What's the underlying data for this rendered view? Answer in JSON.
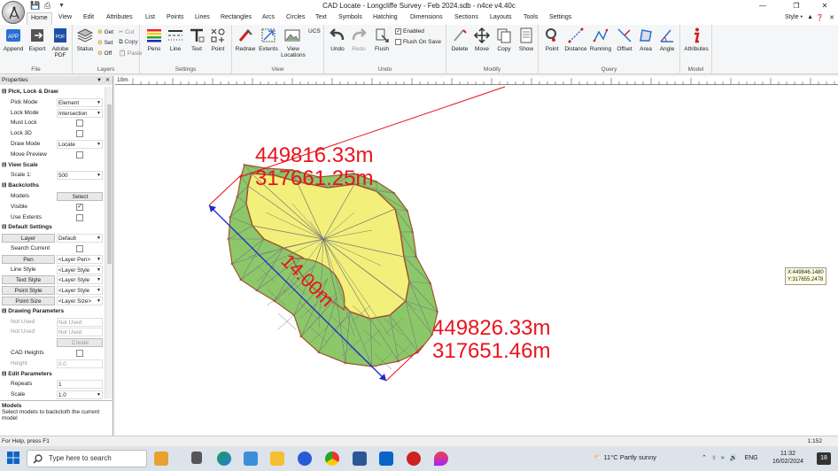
{
  "window": {
    "title": "CAD Locate - Longcliffe Survey - Feb 2024.sdb - n4ce v4.40c",
    "minimize": "—",
    "maximize": "❐",
    "close": "✕",
    "style_label": "Style •"
  },
  "menu_tabs": [
    "Home",
    "View",
    "Edit",
    "Attributes",
    "List",
    "Points",
    "Lines",
    "Rectangles",
    "Arcs",
    "Circles",
    "Text",
    "Symbols",
    "Hatching",
    "Dimensions",
    "Sections",
    "Layouts",
    "Tools",
    "Settings"
  ],
  "ribbon": {
    "file": {
      "label": "File",
      "buttons": [
        "Append",
        "Export",
        "Adobe PDF"
      ]
    },
    "layers": {
      "label": "Layers",
      "status": "Status",
      "get": "Get",
      "cut": "Cut",
      "set": "Set",
      "copy": "Copy",
      "off": "Off",
      "paste": "Paste"
    },
    "settings": {
      "label": "Settings",
      "buttons": [
        "Pens",
        "Line",
        "Text",
        "Point"
      ]
    },
    "view": {
      "label": "View",
      "buttons": [
        "Redraw",
        "Extents",
        "View Locations"
      ],
      "ucs": "UCS"
    },
    "undo": {
      "label": "Undo",
      "buttons": [
        "Undo",
        "Redo",
        "Flush"
      ],
      "enabled": "Enabled",
      "flush_on_save": "Flush On Save"
    },
    "modify": {
      "label": "Modify",
      "buttons": [
        "Delete",
        "Move",
        "Copy",
        "Show"
      ]
    },
    "query": {
      "label": "Query",
      "buttons": [
        "Point",
        "Distance",
        "Running",
        "Offset",
        "Area",
        "Angle"
      ]
    },
    "model": {
      "label": "Model",
      "buttons": [
        "Attributes"
      ]
    }
  },
  "panel": {
    "title": "Properties",
    "sections": [
      {
        "title": "Pick, Lock & Draw",
        "rows": [
          {
            "key": "Pick Mode",
            "value": "Element",
            "type": "dropdown"
          },
          {
            "key": "Lock Mode",
            "value": "Intersection",
            "type": "dropdown"
          },
          {
            "key": "Must Lock",
            "value": "",
            "type": "checkbox",
            "checked": false
          },
          {
            "key": "Lock 3D",
            "value": "",
            "type": "checkbox",
            "checked": false
          },
          {
            "key": "Draw Mode",
            "value": "Locate",
            "type": "dropdown"
          },
          {
            "key": "Move Preview",
            "value": "",
            "type": "checkbox",
            "checked": false
          }
        ]
      },
      {
        "title": "View Scale",
        "rows": [
          {
            "key": "Scale 1:",
            "value": "500",
            "type": "dropdown"
          }
        ]
      },
      {
        "title": "Backcloths",
        "rows": [
          {
            "key": "Models",
            "value": "Select",
            "type": "button"
          },
          {
            "key": "Visible",
            "value": "",
            "type": "checkbox",
            "checked": true
          },
          {
            "key": "Use Extents",
            "value": "",
            "type": "checkbox",
            "checked": false
          }
        ]
      },
      {
        "title": "Default Settings",
        "rows": [
          {
            "key": "Layer",
            "value": "Default",
            "type": "dropdown",
            "keybtn": true
          },
          {
            "key": "Search Current",
            "value": "",
            "type": "checkbox",
            "checked": false
          },
          {
            "key": "Pen",
            "value": "<Layer Pen>",
            "type": "dropdown",
            "keybtn": true
          },
          {
            "key": "Line Style",
            "value": "<Layer Style",
            "type": "dropdown"
          },
          {
            "key": "Text Style",
            "value": "<Layer Style",
            "type": "dropdown",
            "keybtn": true
          },
          {
            "key": "Point Style",
            "value": "<Layer Style",
            "type": "dropdown",
            "keybtn": true
          },
          {
            "key": "Point Size",
            "value": "<Layer Size>",
            "type": "dropdown",
            "keybtn": true
          }
        ]
      },
      {
        "title": "Drawing Parameters",
        "rows": [
          {
            "key": "Not Used",
            "value": "Not Used",
            "type": "disabled"
          },
          {
            "key": "Not Used",
            "value": "Not Used",
            "type": "disabled"
          },
          {
            "key": "",
            "value": "Create",
            "type": "button-disabled"
          },
          {
            "key": "CAD Heights",
            "value": "",
            "type": "checkbox",
            "checked": false
          },
          {
            "key": "Height",
            "value": "0.0",
            "type": "disabled"
          }
        ]
      },
      {
        "title": "Edit Parameters",
        "rows": [
          {
            "key": "Repeats",
            "value": "1",
            "type": "text"
          },
          {
            "key": "Scale",
            "value": "1.0",
            "type": "dropdown"
          }
        ]
      }
    ],
    "description_title": "Models",
    "description_text": "Select models to backcloth the current model"
  },
  "canvas": {
    "ruler_label": "10m",
    "coord_top_left": [
      "449816.33m",
      "317661.25m"
    ],
    "coord_bottom_right": [
      "449826.33m",
      "317651.46m"
    ],
    "dimension_label": "14.00m",
    "cursor_readout": [
      "X:449846.1480",
      "Y:317655.2478"
    ],
    "colors": {
      "annotation": "#e8141e",
      "dimension": "#1a2ad0",
      "fill_outer": "#8cc86a",
      "fill_inner": "#f2f07a",
      "mesh": "#777777",
      "edge": "#a0522d"
    }
  },
  "status": {
    "help": "For Help, press F1",
    "scale": "1:152"
  },
  "taskbar": {
    "search_placeholder": "Type here to search",
    "weather": "11°C  Partly sunny",
    "language": "ENG",
    "time": "11:32",
    "date": "16/02/2024",
    "notifications": "18"
  }
}
